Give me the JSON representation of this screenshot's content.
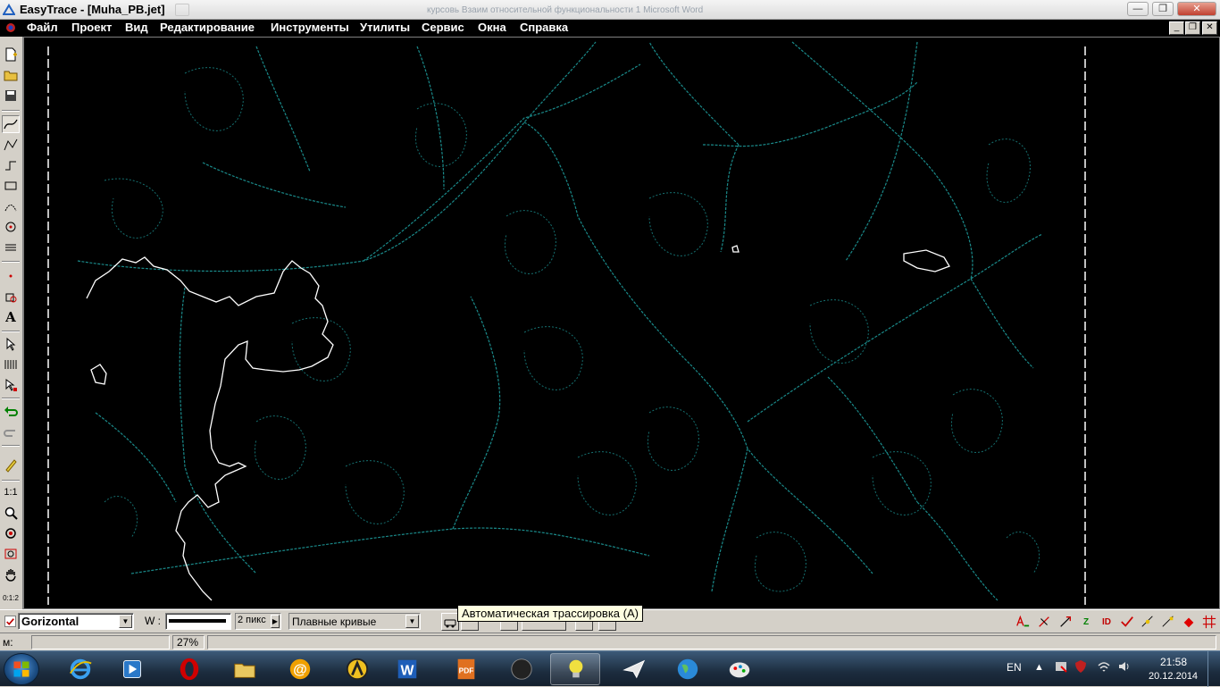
{
  "window": {
    "title": "EasyTrace - [Muha_PB.jet]",
    "background_title": "курсовь Взаим относительной функциональности 1 Microsoft Word"
  },
  "menu": {
    "items": [
      "Файл",
      "Проект",
      "Вид",
      "Редактирование",
      "Инструменты",
      "Утилиты",
      "Сервис",
      "Окна",
      "Справка"
    ]
  },
  "left_toolbar": {
    "scale_label": "1:1",
    "zoom_hint": "0:1:2"
  },
  "status": {
    "layer_name": "Gorizontal",
    "width_label": "W :",
    "width_value": "2 пикс",
    "curve_mode": "Плавные кривые",
    "tooltip": "Автоматическая трассировка (A)"
  },
  "info": {
    "coord_label": "м:",
    "zoom_level": "27%"
  },
  "taskbar": {
    "language": "EN",
    "time": "21:58",
    "date": "20.12.2014"
  },
  "colors": {
    "trace_lines": "#1a8a8a",
    "selected_lines": "#ffffff",
    "canvas_bg": "#000000",
    "menu_bg": "#000000"
  }
}
